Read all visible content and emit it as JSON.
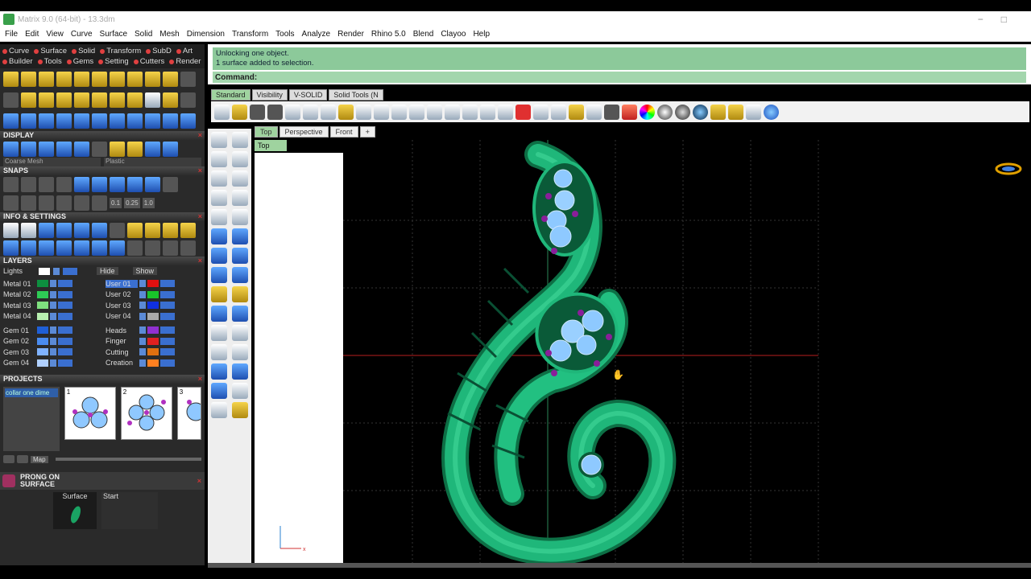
{
  "window": {
    "title": "Matrix 9.0 (64-bit) - 13.3dm",
    "minimize": "−",
    "maximize": "□"
  },
  "menu": [
    "File",
    "Edit",
    "View",
    "Curve",
    "Surface",
    "Solid",
    "Mesh",
    "Dimension",
    "Transform",
    "Tools",
    "Analyze",
    "Render",
    "Rhino 5.0",
    "Blend",
    "Clayoo",
    "Help"
  ],
  "left_tabs": [
    "Curve",
    "Surface",
    "Solid",
    "Transform",
    "SubD",
    "Art",
    "Builder",
    "Tools",
    "Gems",
    "Setting",
    "Cutters",
    "Render"
  ],
  "sections": {
    "display": "DISPLAY",
    "snaps": "SNAPS",
    "info": "INFO & SETTINGS",
    "layers": "LAYERS",
    "projects": "PROJECTS"
  },
  "display": {
    "mesh": "Coarse Mesh",
    "material": "Plastic"
  },
  "snap_values": [
    "0.1",
    "0.25",
    "1.0"
  ],
  "layers": {
    "lights": "Lights",
    "hide": "Hide",
    "show": "Show",
    "left": [
      {
        "name": "Metal 01",
        "color": "#0d8f3f"
      },
      {
        "name": "Metal 02",
        "color": "#2ecc55"
      },
      {
        "name": "Metal 03",
        "color": "#7fe07f"
      },
      {
        "name": "Metal 04",
        "color": "#b8f0b0"
      },
      {
        "name": "Gem 01",
        "color": "#1f5fd6"
      },
      {
        "name": "Gem 02",
        "color": "#4a8cf0"
      },
      {
        "name": "Gem 03",
        "color": "#7fb2ff"
      },
      {
        "name": "Gem 04",
        "color": "#b0d0ff"
      }
    ],
    "right": [
      {
        "name": "User 01",
        "color": "#e01010"
      },
      {
        "name": "User 02",
        "color": "#19c42a"
      },
      {
        "name": "User 03",
        "color": "#1030e0"
      },
      {
        "name": "User 04",
        "color": "#aaaaaa"
      },
      {
        "name": "Heads",
        "color": "#9030d0"
      },
      {
        "name": "Finger",
        "color": "#e02020"
      },
      {
        "name": "Cutting",
        "color": "#e07010"
      },
      {
        "name": "Creation",
        "color": "#ff8020"
      }
    ]
  },
  "projects": {
    "list_item": "collar one dime",
    "thumbs": [
      "1",
      "2",
      "3"
    ],
    "map": "Map"
  },
  "prong": {
    "label": "PRONG ON SURFACE"
  },
  "bottom": {
    "surface": "Surface",
    "start": "Start"
  },
  "command": {
    "line1": "Unlocking one object.",
    "line2": "1 surface added to selection.",
    "prompt": "Command:"
  },
  "tool_tabs": [
    "Standard",
    "Visibility",
    "V-SOLID",
    "Solid Tools (N"
  ],
  "viewport_tabs": [
    "Top",
    "Perspective",
    "Front",
    "+"
  ],
  "viewport": {
    "label": "Top"
  }
}
